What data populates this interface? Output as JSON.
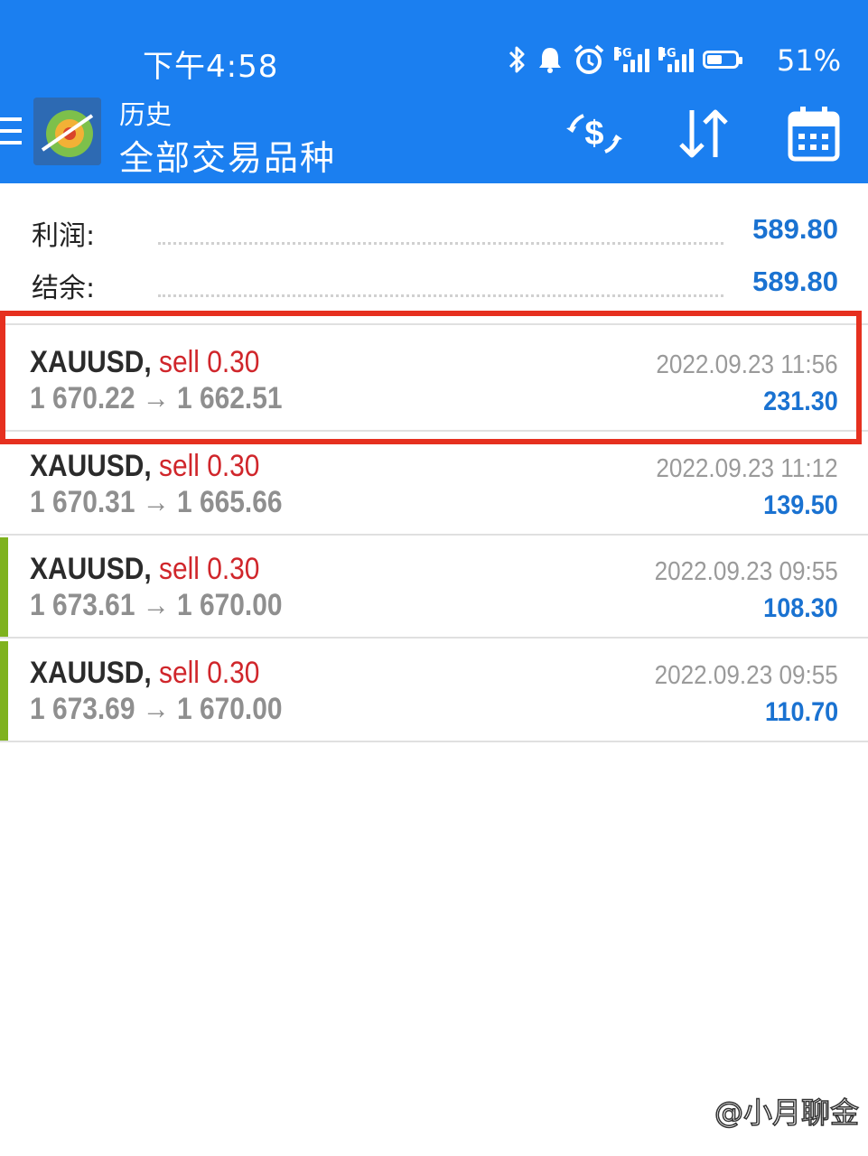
{
  "status_bar": {
    "time": "下午4:58",
    "battery_percent": "51%",
    "network_1": "5G",
    "network_2": "4G"
  },
  "header": {
    "subtitle": "历史",
    "title": "全部交易品种"
  },
  "summary": {
    "profit_label": "利润:",
    "profit_value": "589.80",
    "balance_label": "结余:",
    "balance_value": "589.80"
  },
  "trades": [
    {
      "symbol": "XAUUSD,",
      "side": "sell 0.30",
      "prices": "1 670.22 → 1 662.51",
      "time": "2022.09.23 11:56",
      "profit": "231.30"
    },
    {
      "symbol": "XAUUSD,",
      "side": "sell 0.30",
      "prices": "1 670.31 → 1 665.66",
      "time": "2022.09.23 11:12",
      "profit": "139.50"
    },
    {
      "symbol": "XAUUSD,",
      "side": "sell 0.30",
      "prices": "1 673.61 → 1 670.00",
      "time": "2022.09.23 09:55",
      "profit": "108.30"
    },
    {
      "symbol": "XAUUSD,",
      "side": "sell 0.30",
      "prices": "1 673.69 → 1 670.00",
      "time": "2022.09.23 09:55",
      "profit": "110.70"
    }
  ],
  "watermark": "@小月聊金",
  "colors": {
    "header_bg": "#1b7ff0",
    "profit_blue": "#1a72d1",
    "sell_red": "#d0262b",
    "accent_green": "#7fb21e",
    "highlight_red": "#e6301f"
  },
  "icons": [
    "bluetooth-icon",
    "bell-icon",
    "alarm-icon",
    "signal-icon",
    "battery-icon",
    "menu-icon",
    "metatrader-logo",
    "currency-exchange-icon",
    "sort-icon",
    "calendar-icon"
  ]
}
